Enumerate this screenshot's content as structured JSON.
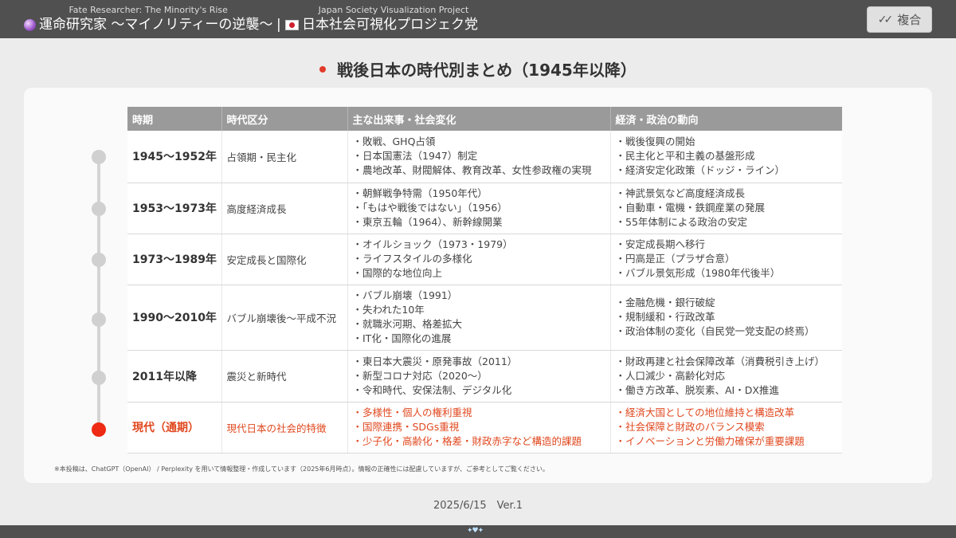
{
  "header": {
    "left_sub": "Fate Researcher: The Minority's Rise",
    "left_main": "運命研究家 〜マイノリティーの逆襲〜",
    "separator": "|",
    "right_sub": "Japan Society Visualization Project",
    "right_main": "日本社会可視化プロジェク党",
    "copy_label": "複合",
    "icons": [
      "crystal-ball-icon",
      "japan-flag-icon",
      "double-check-icon"
    ]
  },
  "page_title": "戦後日本の時代別まとめ（1945年以降）",
  "table": {
    "columns": [
      "時期",
      "時代区分",
      "主な出来事・社会変化",
      "経済・政治の動向"
    ],
    "rows": [
      {
        "period": "1945〜1952年",
        "era": "占領期・民主化",
        "events": [
          "・敗戦、GHQ占領",
          "・日本国憲法（1947）制定",
          "・農地改革、財閥解体、教育改革、女性参政権の実現"
        ],
        "economy": [
          "・戦後復興の開始",
          "・民主化と平和主義の基盤形成",
          "・経済安定化政策（ドッジ・ライン）"
        ]
      },
      {
        "period": "1953〜1973年",
        "era": "高度経済成長",
        "events": [
          "・朝鮮戦争特需（1950年代）",
          "・「もはや戦後ではない」（1956）",
          "・東京五輪（1964）、新幹線開業"
        ],
        "economy": [
          "・神武景気など高度経済成長",
          "・自動車・電機・鉄鋼産業の発展",
          "・55年体制による政治の安定"
        ]
      },
      {
        "period": "1973〜1989年",
        "era": "安定成長と国際化",
        "events": [
          "・オイルショック（1973・1979）",
          "・ライフスタイルの多様化",
          "・国際的な地位向上"
        ],
        "economy": [
          "・安定成長期へ移行",
          "・円高是正（プラザ合意）",
          "・バブル景気形成（1980年代後半）"
        ]
      },
      {
        "period": "1990〜2010年",
        "era": "バブル崩壊後〜平成不況",
        "events": [
          "・バブル崩壊（1991）",
          "・失われた10年",
          "・就職氷河期、格差拡大",
          "・IT化・国際化の進展"
        ],
        "economy": [
          "・金融危機・銀行破綻",
          "・規制緩和・行政改革",
          "・政治体制の変化（自民党一党支配の終焉）"
        ]
      },
      {
        "period": "2011年以降",
        "era": "震災と新時代",
        "events": [
          "・東日本大震災・原発事故（2011）",
          "・新型コロナ対応（2020〜）",
          "・令和時代、安保法制、デジタル化"
        ],
        "economy": [
          "・財政再建と社会保障改革（消費税引き上げ）",
          "・人口減少・高齢化対応",
          "・働き方改革、脱炭素、AI・DX推進"
        ]
      },
      {
        "period": "現代（通期）",
        "era": "現代日本の社会的特徴",
        "events": [
          "・多様性・個人の権利重視",
          "・国際連携・SDGs重視",
          "・少子化・高齢化・格差・財政赤字など構造的課題"
        ],
        "economy": [
          "・経済大国としての地位維持と構造改革",
          "・社会保障と財政のバランス模索",
          "・イノベーションと労働力確保が重要課題"
        ]
      }
    ]
  },
  "note": "※本投稿は、ChatGPT（OpenAI） / Perplexity を用いて情報整理・作成しています（2025年6月時点）。情報の正確性には配慮していますが、ご参考としてご覧ください。",
  "footer_date": "2025/6/15　Ver.1",
  "colors": {
    "accent": "#ee2a14",
    "header_bg": "#505050",
    "table_header": "#9a9a9a"
  }
}
